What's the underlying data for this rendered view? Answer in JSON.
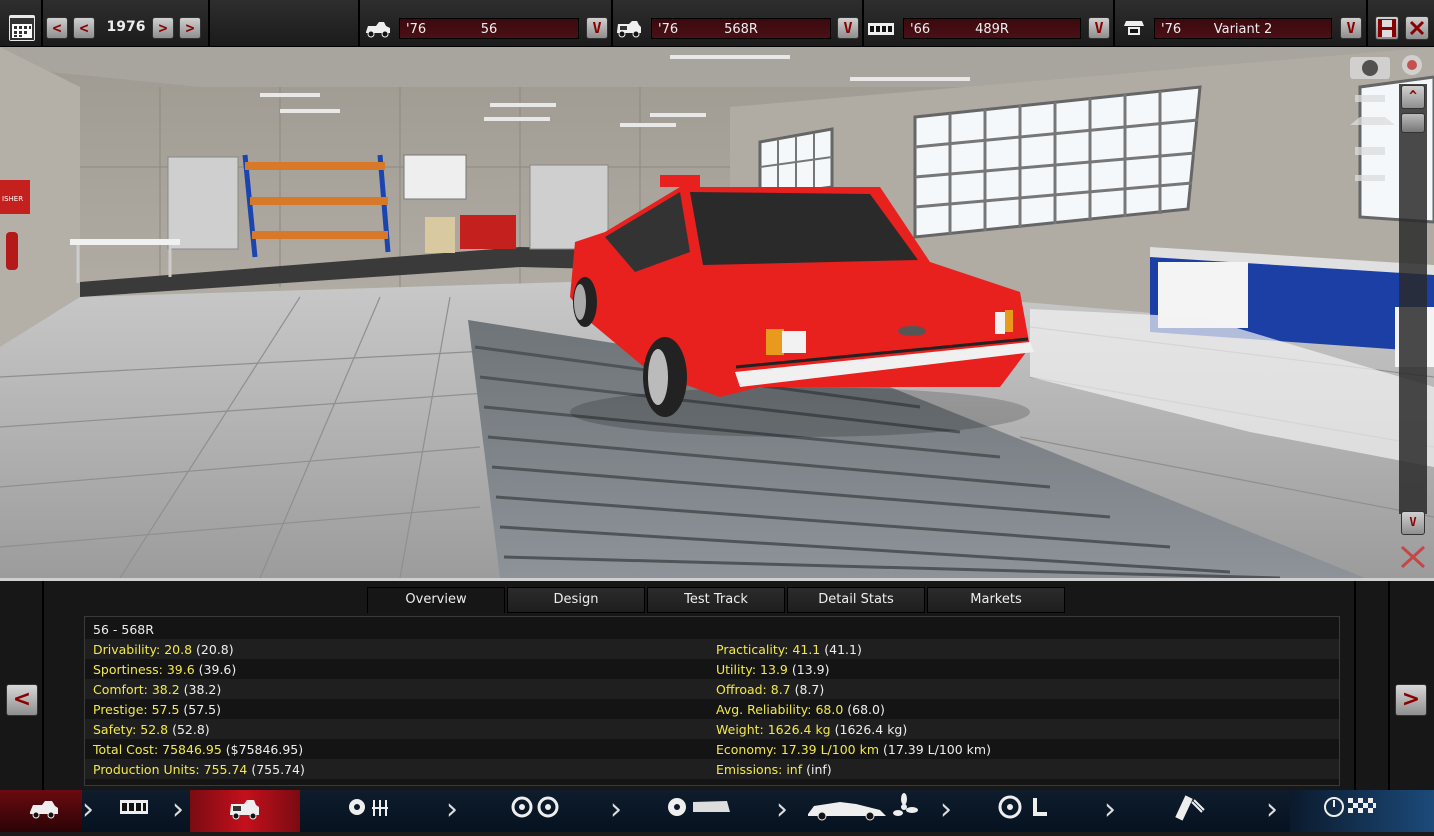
{
  "topbar": {
    "year": "1976",
    "prev_fast": "<",
    "prev": "<",
    "next": ">",
    "next_fast": ">",
    "dropdown": "V",
    "selectors": [
      {
        "icon": "car-body-icon",
        "year": "'76",
        "name": "56"
      },
      {
        "icon": "car-trim-icon",
        "year": "'76",
        "name": "568R"
      },
      {
        "icon": "engine-icon",
        "year": "'66",
        "name": "489R"
      },
      {
        "icon": "engine-variant-icon",
        "year": "'76",
        "name": "Variant 2"
      }
    ]
  },
  "scene": {
    "sign_text": "ISHER",
    "scroll_up": "^",
    "scroll_down": "V"
  },
  "tabs": [
    "Overview",
    "Design",
    "Test Track",
    "Detail Stats",
    "Markets"
  ],
  "stats": {
    "title": "56 - 568R",
    "left": [
      {
        "label": "Drivability: 20.8",
        "value": "(20.8)"
      },
      {
        "label": "Sportiness: 39.6",
        "value": "(39.6)"
      },
      {
        "label": "Comfort: 38.2",
        "value": "(38.2)"
      },
      {
        "label": "Prestige: 57.5",
        "value": "(57.5)"
      },
      {
        "label": "Safety: 52.8",
        "value": "(52.8)"
      },
      {
        "label": "Total Cost: 75846.95",
        "value": "($75846.95)"
      },
      {
        "label": "Production Units: 755.74",
        "value": "(755.74)"
      }
    ],
    "right": [
      {
        "label": "Practicality: 41.1",
        "value": "(41.1)"
      },
      {
        "label": "Utility: 13.9",
        "value": "(13.9)"
      },
      {
        "label": "Offroad: 8.7",
        "value": "(8.7)"
      },
      {
        "label": "Avg. Reliability: 68.0",
        "value": "(68.0)"
      },
      {
        "label": "Weight: 1626.4 kg",
        "value": "(1626.4 kg)"
      },
      {
        "label": "Economy: 17.39 L/100 km",
        "value": "(17.39 L/100 km)"
      },
      {
        "label": "Emissions: inf",
        "value": "(inf)"
      }
    ]
  },
  "panel_nav": {
    "prev": "<",
    "next": ">"
  },
  "colors": {
    "accent": "#8a0000",
    "stat_key": "#f2e84a",
    "car": "#e8201e"
  }
}
